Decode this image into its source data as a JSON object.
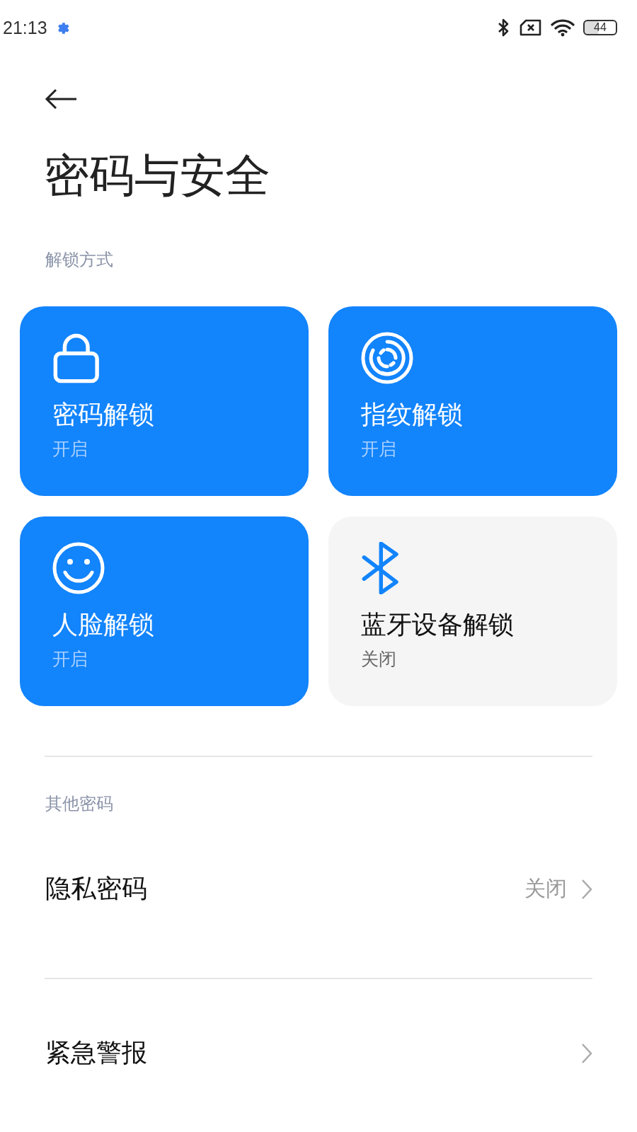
{
  "status_bar": {
    "time": "21:13",
    "battery": "44"
  },
  "title": "密码与安全",
  "unlock_section": {
    "heading": "解锁方式",
    "tiles": [
      {
        "kind": "lock",
        "label": "密码解锁",
        "status": "开启",
        "on": true
      },
      {
        "kind": "fingerprint",
        "label": "指纹解锁",
        "status": "开启",
        "on": true
      },
      {
        "kind": "face",
        "label": "人脸解锁",
        "status": "开启",
        "on": true
      },
      {
        "kind": "bluetooth",
        "label": "蓝牙设备解锁",
        "status": "关闭",
        "on": false
      }
    ]
  },
  "other_section": {
    "heading": "其他密码",
    "items": [
      {
        "label": "隐私密码",
        "value": "关闭"
      },
      {
        "label": "紧急警报"
      }
    ]
  }
}
